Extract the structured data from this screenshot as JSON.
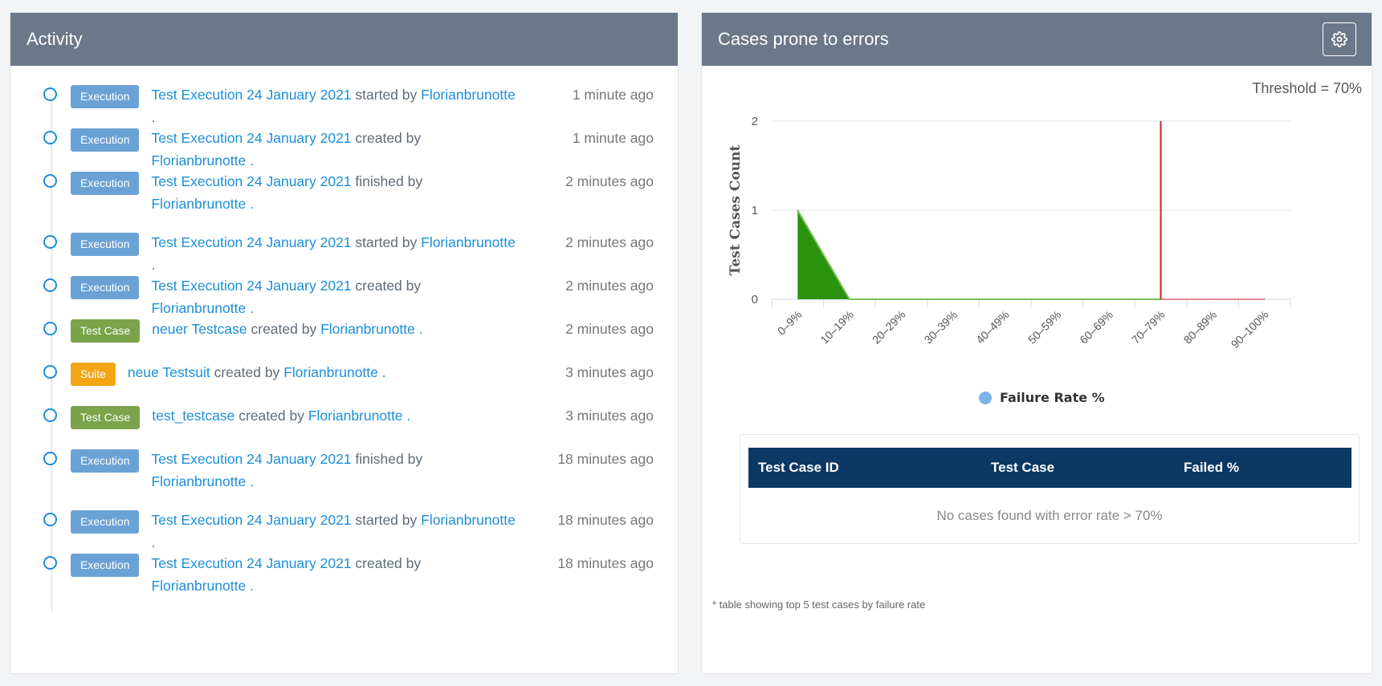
{
  "activity": {
    "title": "Activity",
    "items": [
      {
        "badge": "Execution",
        "badge_type": "execution",
        "subject": "Test Execution 24 January 2021",
        "action": " started by ",
        "user": "Florianbrunotte",
        "tail": " .",
        "time": "1 minute ago"
      },
      {
        "badge": "Execution",
        "badge_type": "execution",
        "subject": "Test Execution 24 January 2021",
        "action": " created by ",
        "user": "Florianbrunotte",
        "tail": " .",
        "time": "1 minute ago"
      },
      {
        "badge": "Execution",
        "badge_type": "execution",
        "subject": "Test Execution 24 January 2021",
        "action": " finished by ",
        "user": "Florianbrunotte",
        "tail": " .",
        "time": "2 minutes ago",
        "wrap": true
      },
      {
        "badge": "Execution",
        "badge_type": "execution",
        "subject": "Test Execution 24 January 2021",
        "action": " started by ",
        "user": "Florianbrunotte",
        "tail": " .",
        "time": "2 minutes ago"
      },
      {
        "badge": "Execution",
        "badge_type": "execution",
        "subject": "Test Execution 24 January 2021",
        "action": " created by ",
        "user": "Florianbrunotte",
        "tail": " .",
        "time": "2 minutes ago"
      },
      {
        "badge": "Test Case",
        "badge_type": "testcase",
        "subject": "neuer Testcase",
        "action": " created by ",
        "user": "Florianbrunotte",
        "tail": " .",
        "time": "2 minutes ago"
      },
      {
        "badge": "Suite",
        "badge_type": "suite",
        "subject": "neue Testsuit",
        "action": " created by ",
        "user": "Florianbrunotte",
        "tail": " .",
        "time": "3 minutes ago"
      },
      {
        "badge": "Test Case",
        "badge_type": "testcase",
        "subject": "test_testcase",
        "action": " created by ",
        "user": "Florianbrunotte",
        "tail": " .",
        "time": "3 minutes ago"
      },
      {
        "badge": "Execution",
        "badge_type": "execution",
        "subject": "Test Execution 24 January 2021",
        "action": " finished by ",
        "user": "Florianbrunotte",
        "tail": " .",
        "time": "18 minutes ago",
        "wrap": true
      },
      {
        "badge": "Execution",
        "badge_type": "execution",
        "subject": "Test Execution 24 January 2021",
        "action": " started by ",
        "user": "Florianbrunotte",
        "tail": " .",
        "time": "18 minutes ago"
      },
      {
        "badge": "Execution",
        "badge_type": "execution",
        "subject": "Test Execution 24 January 2021",
        "action": " created by ",
        "user": "Florianbrunotte",
        "tail": " .",
        "time": "18 minutes ago"
      }
    ]
  },
  "errors": {
    "title": "Cases prone to errors",
    "settings_icon": "gear-icon",
    "threshold_label": "Threshold = 70%",
    "table": {
      "columns": [
        "Test Case ID",
        "Test Case",
        "Failed %"
      ],
      "empty_message": "No cases found with error rate > 70%"
    },
    "footnote": "* table showing top 5 test cases by failure rate"
  },
  "chart_data": {
    "type": "area",
    "categories": [
      "0–9%",
      "10–19%",
      "20–29%",
      "30–39%",
      "40–49%",
      "50–59%",
      "60–69%",
      "70–79%",
      "80–89%",
      "90–100%"
    ],
    "series": [
      {
        "name": "Failure Rate %",
        "values": [
          1,
          0,
          0,
          0,
          0,
          0,
          0,
          0,
          0,
          0
        ]
      }
    ],
    "ylabel": "Test Cases Count",
    "xlabel": "",
    "ylim": [
      0,
      2
    ],
    "yticks": [
      0,
      1,
      2
    ],
    "threshold_category": "70–79%",
    "colors": {
      "area": "#2a930e",
      "line": "#7cc05a",
      "threshold": "#d21f1f",
      "after_threshold": "#e8899b",
      "legend": "#7cb3e8"
    },
    "grid": true,
    "legend_position": "bottom-center"
  }
}
